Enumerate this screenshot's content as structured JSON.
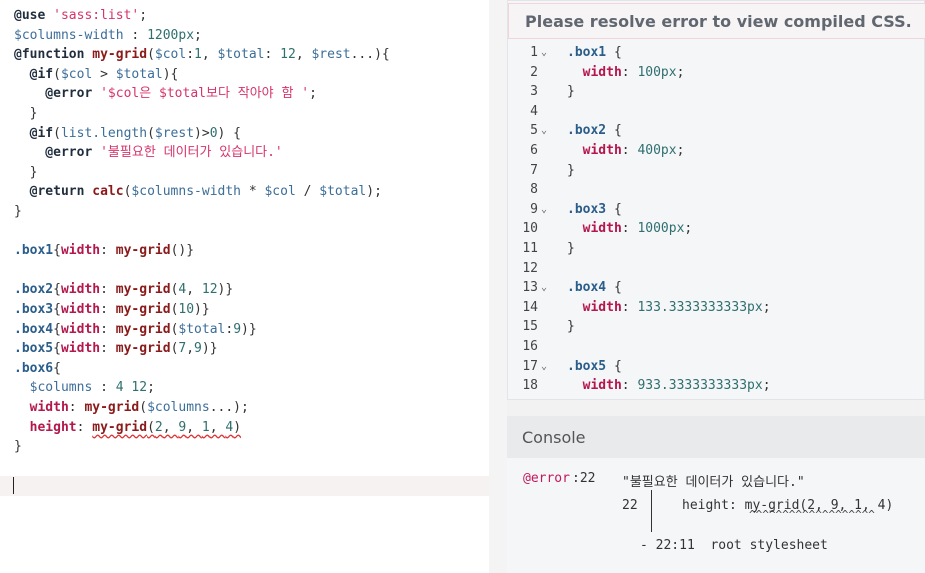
{
  "editor": {
    "lines": [
      [
        {
          "t": "@use",
          "c": "k-at"
        },
        {
          "t": " ",
          "c": "k-plain"
        },
        {
          "t": "'sass:list'",
          "c": "k-str"
        },
        {
          "t": ";",
          "c": "k-plain"
        }
      ],
      [
        {
          "t": "$columns-width",
          "c": "k-var"
        },
        {
          "t": " : ",
          "c": "k-plain"
        },
        {
          "t": "1200px",
          "c": "k-num"
        },
        {
          "t": ";",
          "c": "k-plain"
        }
      ],
      [
        {
          "t": "@function",
          "c": "k-at"
        },
        {
          "t": " ",
          "c": "k-plain"
        },
        {
          "t": "my-grid",
          "c": "k-fn"
        },
        {
          "t": "(",
          "c": "k-plain"
        },
        {
          "t": "$col",
          "c": "k-var"
        },
        {
          "t": ":",
          "c": "k-plain"
        },
        {
          "t": "1",
          "c": "k-num"
        },
        {
          "t": ", ",
          "c": "k-plain"
        },
        {
          "t": "$total",
          "c": "k-var"
        },
        {
          "t": ": ",
          "c": "k-plain"
        },
        {
          "t": "12",
          "c": "k-num"
        },
        {
          "t": ", ",
          "c": "k-plain"
        },
        {
          "t": "$rest",
          "c": "k-var"
        },
        {
          "t": "...){",
          "c": "k-plain"
        }
      ],
      [
        {
          "t": "  @if",
          "c": "k-at"
        },
        {
          "t": "(",
          "c": "k-plain"
        },
        {
          "t": "$col",
          "c": "k-var"
        },
        {
          "t": " > ",
          "c": "k-plain"
        },
        {
          "t": "$total",
          "c": "k-var"
        },
        {
          "t": "){",
          "c": "k-plain"
        }
      ],
      [
        {
          "t": "    @error",
          "c": "k-at"
        },
        {
          "t": " ",
          "c": "k-plain"
        },
        {
          "t": "'$col은 $total보다 작아야 함 '",
          "c": "k-str"
        },
        {
          "t": ";",
          "c": "k-plain"
        }
      ],
      [
        {
          "t": "  }",
          "c": "k-plain"
        }
      ],
      [
        {
          "t": "  @if",
          "c": "k-at"
        },
        {
          "t": "(",
          "c": "k-plain"
        },
        {
          "t": "list.length",
          "c": "k-var"
        },
        {
          "t": "(",
          "c": "k-plain"
        },
        {
          "t": "$rest",
          "c": "k-var"
        },
        {
          "t": ")>",
          "c": "k-plain"
        },
        {
          "t": "0",
          "c": "k-num"
        },
        {
          "t": ") {",
          "c": "k-plain"
        }
      ],
      [
        {
          "t": "    @error",
          "c": "k-at"
        },
        {
          "t": " ",
          "c": "k-plain"
        },
        {
          "t": "'불필요한 데이터가 있습니다.'",
          "c": "k-str"
        }
      ],
      [
        {
          "t": "  }",
          "c": "k-plain"
        }
      ],
      [
        {
          "t": "  @return",
          "c": "k-at"
        },
        {
          "t": " ",
          "c": "k-plain"
        },
        {
          "t": "calc",
          "c": "k-fn"
        },
        {
          "t": "(",
          "c": "k-plain"
        },
        {
          "t": "$columns-width",
          "c": "k-var"
        },
        {
          "t": " * ",
          "c": "k-plain"
        },
        {
          "t": "$col",
          "c": "k-var"
        },
        {
          "t": " / ",
          "c": "k-plain"
        },
        {
          "t": "$total",
          "c": "k-var"
        },
        {
          "t": ");",
          "c": "k-plain"
        }
      ],
      [
        {
          "t": "}",
          "c": "k-plain"
        }
      ],
      [],
      [
        {
          "t": ".box1",
          "c": "k-sel"
        },
        {
          "t": "{",
          "c": "k-plain"
        },
        {
          "t": "width",
          "c": "k-prop"
        },
        {
          "t": ": ",
          "c": "k-plain"
        },
        {
          "t": "my-grid",
          "c": "k-fn"
        },
        {
          "t": "()}",
          "c": "k-plain"
        }
      ],
      [],
      [
        {
          "t": ".box2",
          "c": "k-sel"
        },
        {
          "t": "{",
          "c": "k-plain"
        },
        {
          "t": "width",
          "c": "k-prop"
        },
        {
          "t": ": ",
          "c": "k-plain"
        },
        {
          "t": "my-grid",
          "c": "k-fn"
        },
        {
          "t": "(",
          "c": "k-plain"
        },
        {
          "t": "4",
          "c": "k-num"
        },
        {
          "t": ", ",
          "c": "k-plain"
        },
        {
          "t": "12",
          "c": "k-num"
        },
        {
          "t": ")}",
          "c": "k-plain"
        }
      ],
      [
        {
          "t": ".box3",
          "c": "k-sel"
        },
        {
          "t": "{",
          "c": "k-plain"
        },
        {
          "t": "width",
          "c": "k-prop"
        },
        {
          "t": ": ",
          "c": "k-plain"
        },
        {
          "t": "my-grid",
          "c": "k-fn"
        },
        {
          "t": "(",
          "c": "k-plain"
        },
        {
          "t": "10",
          "c": "k-num"
        },
        {
          "t": ")}",
          "c": "k-plain"
        }
      ],
      [
        {
          "t": ".box4",
          "c": "k-sel"
        },
        {
          "t": "{",
          "c": "k-plain"
        },
        {
          "t": "width",
          "c": "k-prop"
        },
        {
          "t": ": ",
          "c": "k-plain"
        },
        {
          "t": "my-grid",
          "c": "k-fn"
        },
        {
          "t": "(",
          "c": "k-plain"
        },
        {
          "t": "$total",
          "c": "k-var"
        },
        {
          "t": ":",
          "c": "k-plain"
        },
        {
          "t": "9",
          "c": "k-num"
        },
        {
          "t": ")}",
          "c": "k-plain"
        }
      ],
      [
        {
          "t": ".box5",
          "c": "k-sel"
        },
        {
          "t": "{",
          "c": "k-plain"
        },
        {
          "t": "width",
          "c": "k-prop"
        },
        {
          "t": ": ",
          "c": "k-plain"
        },
        {
          "t": "my-grid",
          "c": "k-fn"
        },
        {
          "t": "(",
          "c": "k-plain"
        },
        {
          "t": "7",
          "c": "k-num"
        },
        {
          "t": ",",
          "c": "k-plain"
        },
        {
          "t": "9",
          "c": "k-num"
        },
        {
          "t": ")}",
          "c": "k-plain"
        }
      ],
      [
        {
          "t": ".box6",
          "c": "k-sel"
        },
        {
          "t": "{",
          "c": "k-plain"
        }
      ],
      [
        {
          "t": "  $columns",
          "c": "k-var"
        },
        {
          "t": " : ",
          "c": "k-plain"
        },
        {
          "t": "4",
          "c": "k-num"
        },
        {
          "t": " ",
          "c": "k-plain"
        },
        {
          "t": "12",
          "c": "k-num"
        },
        {
          "t": ";",
          "c": "k-plain"
        }
      ],
      [
        {
          "t": "  width",
          "c": "k-prop"
        },
        {
          "t": ": ",
          "c": "k-plain"
        },
        {
          "t": "my-grid",
          "c": "k-fn"
        },
        {
          "t": "(",
          "c": "k-plain"
        },
        {
          "t": "$columns",
          "c": "k-var"
        },
        {
          "t": "...);",
          "c": "k-plain"
        }
      ],
      [
        {
          "t": "  height",
          "c": "k-prop"
        },
        {
          "t": ": ",
          "c": "k-plain"
        },
        {
          "t": "my-grid",
          "c": "k-fn squiggle"
        },
        {
          "t": "(",
          "c": "k-plain squiggle"
        },
        {
          "t": "2",
          "c": "k-num squiggle"
        },
        {
          "t": ", ",
          "c": "k-plain squiggle"
        },
        {
          "t": "9",
          "c": "k-num squiggle"
        },
        {
          "t": ", ",
          "c": "k-plain squiggle"
        },
        {
          "t": "1",
          "c": "k-num squiggle"
        },
        {
          "t": ", ",
          "c": "k-plain squiggle"
        },
        {
          "t": "4",
          "c": "k-num squiggle"
        },
        {
          "t": ")",
          "c": "k-plain squiggle"
        }
      ],
      [
        {
          "t": "}",
          "c": "k-plain"
        }
      ]
    ]
  },
  "compiled": {
    "title": "Please resolve error to view compiled CSS.",
    "lines": [
      {
        "n": "1",
        "fold": true,
        "seg": [
          {
            "t": ".box1",
            "c": "c-sel"
          },
          {
            "t": " {",
            "c": "c-punc"
          }
        ]
      },
      {
        "n": "2",
        "fold": false,
        "seg": [
          {
            "t": "  width",
            "c": "c-prop"
          },
          {
            "t": ": ",
            "c": "c-punc"
          },
          {
            "t": "100px",
            "c": "c-val"
          },
          {
            "t": ";",
            "c": "c-punc"
          }
        ]
      },
      {
        "n": "3",
        "fold": false,
        "seg": [
          {
            "t": "}",
            "c": "c-punc"
          }
        ]
      },
      {
        "n": "4",
        "fold": false,
        "seg": []
      },
      {
        "n": "5",
        "fold": true,
        "seg": [
          {
            "t": ".box2",
            "c": "c-sel"
          },
          {
            "t": " {",
            "c": "c-punc"
          }
        ]
      },
      {
        "n": "6",
        "fold": false,
        "seg": [
          {
            "t": "  width",
            "c": "c-prop"
          },
          {
            "t": ": ",
            "c": "c-punc"
          },
          {
            "t": "400px",
            "c": "c-val"
          },
          {
            "t": ";",
            "c": "c-punc"
          }
        ]
      },
      {
        "n": "7",
        "fold": false,
        "seg": [
          {
            "t": "}",
            "c": "c-punc"
          }
        ]
      },
      {
        "n": "8",
        "fold": false,
        "seg": []
      },
      {
        "n": "9",
        "fold": true,
        "seg": [
          {
            "t": ".box3",
            "c": "c-sel"
          },
          {
            "t": " {",
            "c": "c-punc"
          }
        ]
      },
      {
        "n": "10",
        "fold": false,
        "seg": [
          {
            "t": "  width",
            "c": "c-prop"
          },
          {
            "t": ": ",
            "c": "c-punc"
          },
          {
            "t": "1000px",
            "c": "c-val"
          },
          {
            "t": ";",
            "c": "c-punc"
          }
        ]
      },
      {
        "n": "11",
        "fold": false,
        "seg": [
          {
            "t": "}",
            "c": "c-punc"
          }
        ]
      },
      {
        "n": "12",
        "fold": false,
        "seg": []
      },
      {
        "n": "13",
        "fold": true,
        "seg": [
          {
            "t": ".box4",
            "c": "c-sel"
          },
          {
            "t": " {",
            "c": "c-punc"
          }
        ]
      },
      {
        "n": "14",
        "fold": false,
        "seg": [
          {
            "t": "  width",
            "c": "c-prop"
          },
          {
            "t": ": ",
            "c": "c-punc"
          },
          {
            "t": "133.3333333333px",
            "c": "c-val"
          },
          {
            "t": ";",
            "c": "c-punc"
          }
        ]
      },
      {
        "n": "15",
        "fold": false,
        "seg": [
          {
            "t": "}",
            "c": "c-punc"
          }
        ]
      },
      {
        "n": "16",
        "fold": false,
        "seg": []
      },
      {
        "n": "17",
        "fold": true,
        "seg": [
          {
            "t": ".box5",
            "c": "c-sel"
          },
          {
            "t": " {",
            "c": "c-punc"
          }
        ]
      },
      {
        "n": "18",
        "fold": false,
        "seg": [
          {
            "t": "  width",
            "c": "c-prop"
          },
          {
            "t": ": ",
            "c": "c-punc"
          },
          {
            "t": "933.3333333333px",
            "c": "c-val"
          },
          {
            "t": ";",
            "c": "c-punc"
          }
        ]
      }
    ]
  },
  "console": {
    "title": "Console",
    "error_tag": "@error",
    "error_loc": ":22",
    "message": "\"불필요한 데이터가 있습니다.\"",
    "line_no": "22",
    "source_line": "height: my-grid(2, 9, 1, 4)",
    "carets": "^^^^^^^^^^^^^^^^^^^",
    "trace": "- 22:11  root stylesheet"
  },
  "icons": {
    "fold": "chevron-down-icon"
  }
}
